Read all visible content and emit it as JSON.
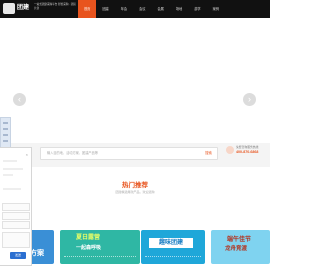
{
  "header": {
    "logo_text": "团建",
    "tagline": "一站式团建采购平台 轻松采购 · 团队共创",
    "nav": [
      "首页",
      "团建",
      "年会",
      "会议",
      "会展",
      "场地",
      "游学",
      "案例"
    ]
  },
  "search": {
    "placeholder": "输入目的地、活动方案、团建产品等",
    "button_label": "搜索"
  },
  "hotline": {
    "label": "免费咨询服务热线",
    "number": "400-870-6868"
  },
  "section": {
    "title": "热门推荐",
    "subtitle": "团建精选爆款产品，欢迎选购"
  },
  "cards": [
    {
      "title": "方案",
      "sub": ""
    },
    {
      "title": "夏日露营",
      "sub": "一起森呼吸"
    },
    {
      "title": "趣味团建",
      "sub": ""
    },
    {
      "title": "端午佳节",
      "sub": "龙舟竞渡"
    }
  ],
  "chat": {
    "close_label": "×",
    "send_label": "发送"
  },
  "carousel": {
    "prev": "‹",
    "next": "›"
  },
  "colors": {
    "accent": "#e8541e",
    "topbar": "#111111"
  }
}
